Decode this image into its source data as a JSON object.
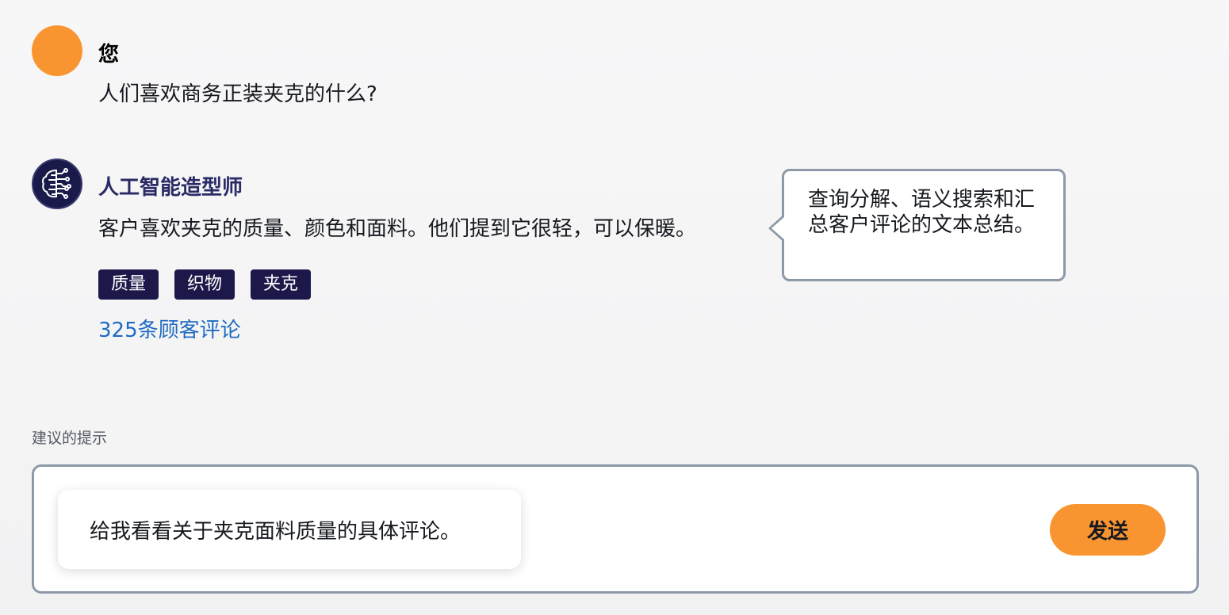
{
  "user_message": {
    "sender": "您",
    "text": "人们喜欢商务正装夹克的什么?",
    "avatar_color": "#f89531"
  },
  "ai_message": {
    "sender": "人工智能造型师",
    "avatar_icon": "ai-brain-circuit-icon",
    "text": "客户喜欢夹克的质量、颜色和面料。他们提到它很轻，可以保暖。",
    "tags": [
      "质量",
      "织物",
      "夹克"
    ],
    "reviews_link": "325条顾客评论"
  },
  "tooltip": {
    "text": "查询分解、语义搜索和汇总客户评论的文本总结。"
  },
  "suggestions": {
    "label": "建议的提示",
    "items": [
      "给我看看关于夹克面料质量的具体评论。"
    ]
  },
  "composer": {
    "send_label": "发送",
    "accent_color": "#f89531"
  }
}
